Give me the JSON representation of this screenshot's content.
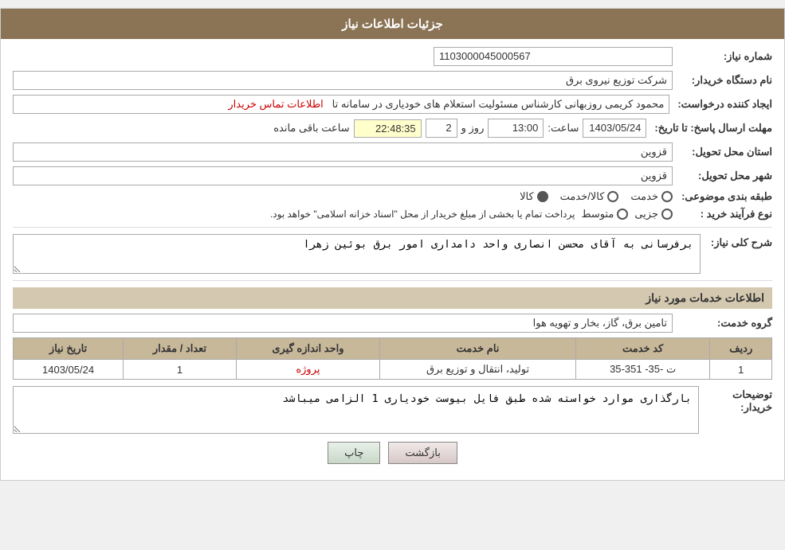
{
  "header": {
    "title": "جزئیات اطلاعات نیاز"
  },
  "fields": {
    "need_number_label": "شماره نیاز:",
    "need_number_value": "1103000045000567",
    "buyer_system_label": "نام دستگاه خریدار:",
    "buyer_system_value": "شرکت توزیع نیروی برق",
    "creator_label": "ایجاد کننده درخواست:",
    "creator_value": "محمود کریمی روزبهانی کارشناس  مسئولیت استعلام های خودیاری در سامانه تا",
    "creator_link": "اطلاعات تماس خریدار",
    "deadline_label": "مهلت ارسال پاسخ: تا تاریخ:",
    "deadline_date": "1403/05/24",
    "deadline_time_label": "ساعت:",
    "deadline_time": "13:00",
    "deadline_days_label": "روز و",
    "deadline_days": "2",
    "deadline_remaining_label": "ساعت باقی مانده",
    "deadline_remaining": "22:48:35",
    "province_label": "استان محل تحویل:",
    "province_value": "قزوین",
    "city_label": "شهر محل تحویل:",
    "city_value": "قزوین",
    "category_label": "طبقه بندی موضوعی:",
    "category_options": [
      "خدمت",
      "کالا/خدمت",
      "کالا"
    ],
    "category_selected": "کالا",
    "purchase_type_label": "نوع فرآیند خرید :",
    "purchase_options": [
      "جزیی",
      "متوسط"
    ],
    "purchase_note": "پرداخت تمام یا بخشی از مبلغ خریدار از محل \"اسناد خزانه اسلامی\" خواهد بود.",
    "need_desc_label": "شرح کلی نیاز:",
    "need_desc_value": "برفرسانی به آقای محسن انصاری واحد دامداری امور برق بوئین زهرا"
  },
  "services_section": {
    "title": "اطلاعات خدمات مورد نیاز",
    "service_group_label": "گروه خدمت:",
    "service_group_value": "تامین برق، گاز، بخار و تهویه هوا",
    "table": {
      "headers": [
        "ردیف",
        "کد خدمت",
        "نام خدمت",
        "واحد اندازه گیری",
        "تعداد / مقدار",
        "تاریخ نیاز"
      ],
      "rows": [
        [
          "1",
          "ت -35- 351-35",
          "تولید، انتقال و توزیع برق",
          "پروژه",
          "1",
          "1403/05/24"
        ]
      ]
    }
  },
  "buyer_desc": {
    "label": "توضیحات خریدار:",
    "value": "بارگذاری موارد خواسته شده طبق فایل بیوست خودیاری 1 الزامی میباشد"
  },
  "buttons": {
    "print": "چاپ",
    "back": "بازگشت"
  }
}
